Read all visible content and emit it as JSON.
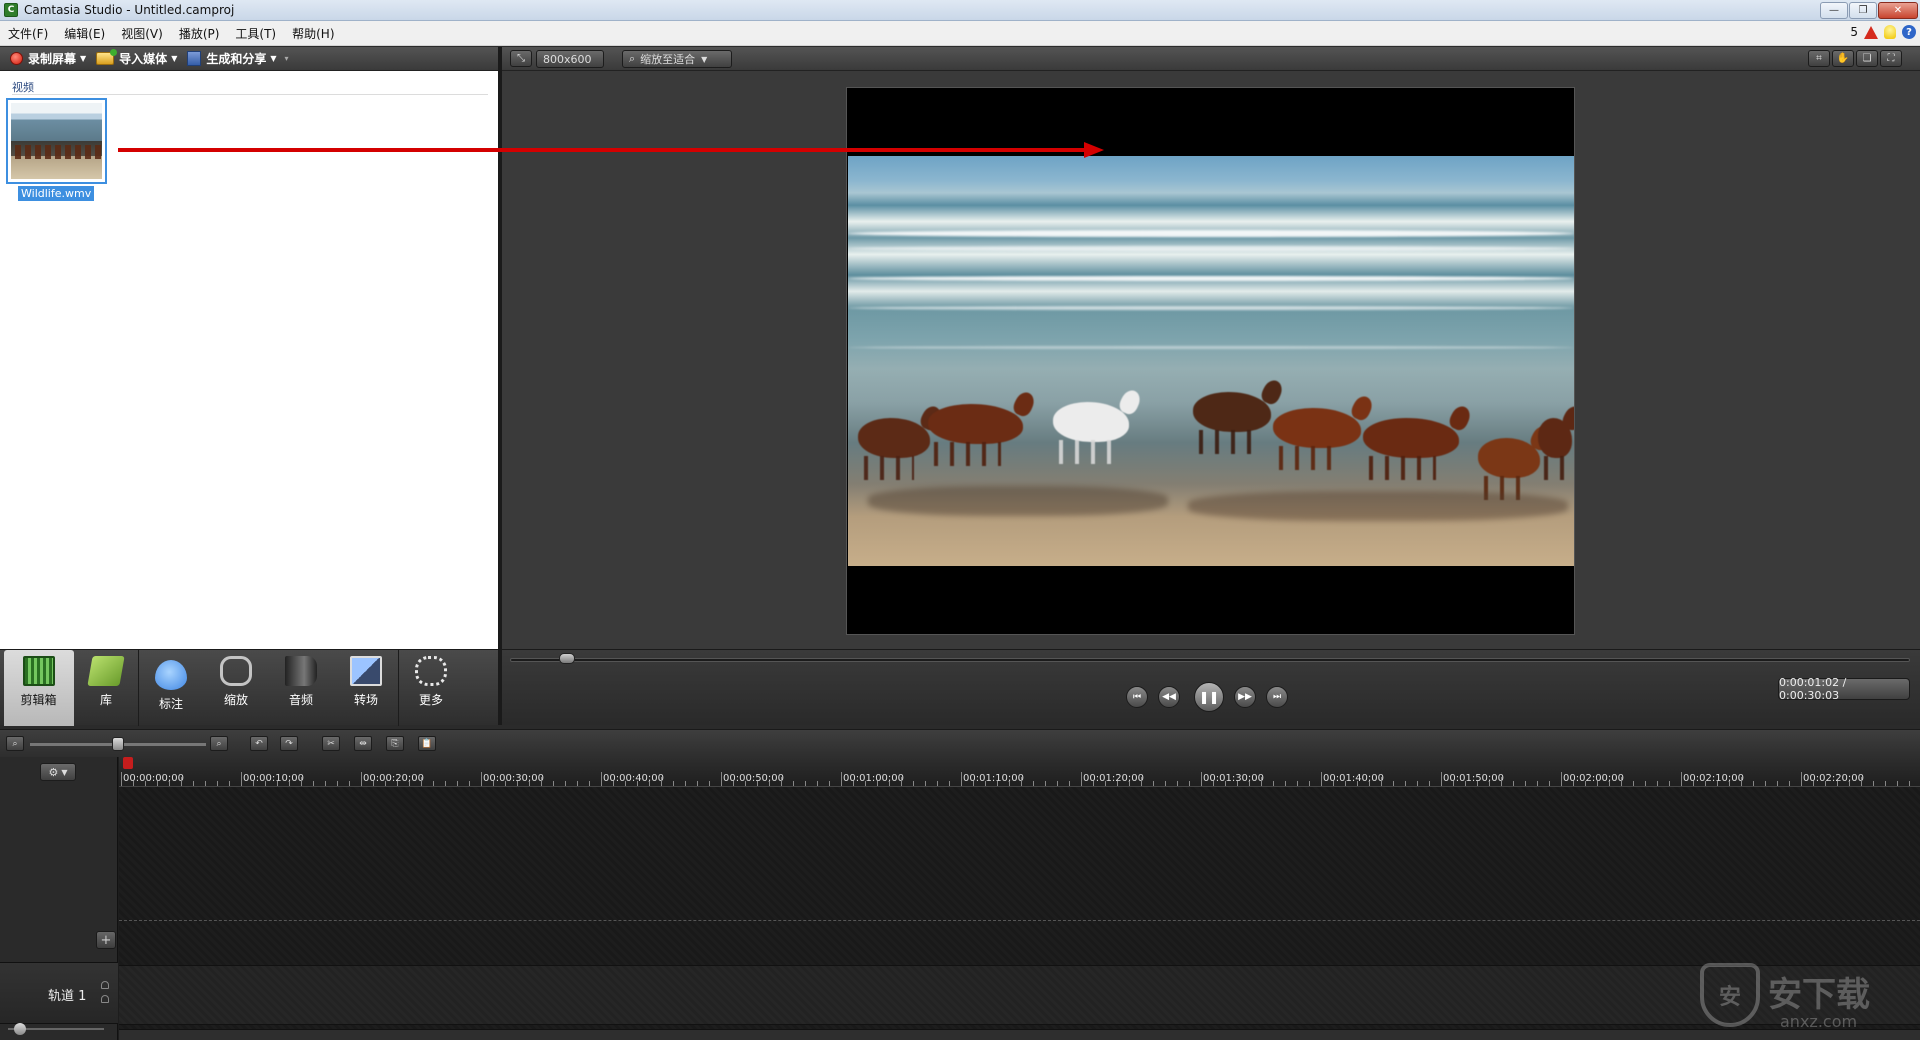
{
  "window": {
    "title": "Camtasia Studio - Untitled.camproj",
    "icon_letter": "C",
    "controls": {
      "minimize": "—",
      "maximize": "❐",
      "close": "✕"
    }
  },
  "menu": {
    "items": [
      "文件(F)",
      "编辑(E)",
      "视图(V)",
      "播放(P)",
      "工具(T)",
      "帮助(H)"
    ],
    "notification_count": "5",
    "help": "?"
  },
  "left_toolbar": {
    "record": "录制屏幕",
    "import": "导入媒体",
    "produce": "生成和分享"
  },
  "clip_bin": {
    "section_label": "视频",
    "clips": [
      {
        "name": "Wildlife.wmv"
      }
    ]
  },
  "left_tabs": [
    "剪辑箱",
    "库",
    "标注",
    "缩放",
    "音频",
    "转场",
    "更多"
  ],
  "preview": {
    "dimensions": "800x600",
    "zoom": "缩放至适合"
  },
  "transport": {
    "time": "0:00:01:02 / 0:00:30:03",
    "progress_fraction": 0.035
  },
  "timeline": {
    "ruler_labels": [
      "00:00:00;00",
      "00:00:10;00",
      "00:00:20;00",
      "00:00:30;00",
      "00:00:40;00",
      "00:00:50;00",
      "00:01:00;00",
      "00:01:10;00",
      "00:01:20;00",
      "00:01:30;00",
      "00:01:40;00",
      "00:01:50;00",
      "00:02:00;00",
      "00:02:10;00",
      "00:02:20;00"
    ],
    "track_name": "轨道 1",
    "add_track": "+"
  },
  "watermark": {
    "text": "安下载",
    "sub": "anxz.com",
    "shield": "安"
  },
  "colors": {
    "accent_selection": "#3d8fe0",
    "record_red": "#d21a0b",
    "arrow_red": "#d40000"
  }
}
